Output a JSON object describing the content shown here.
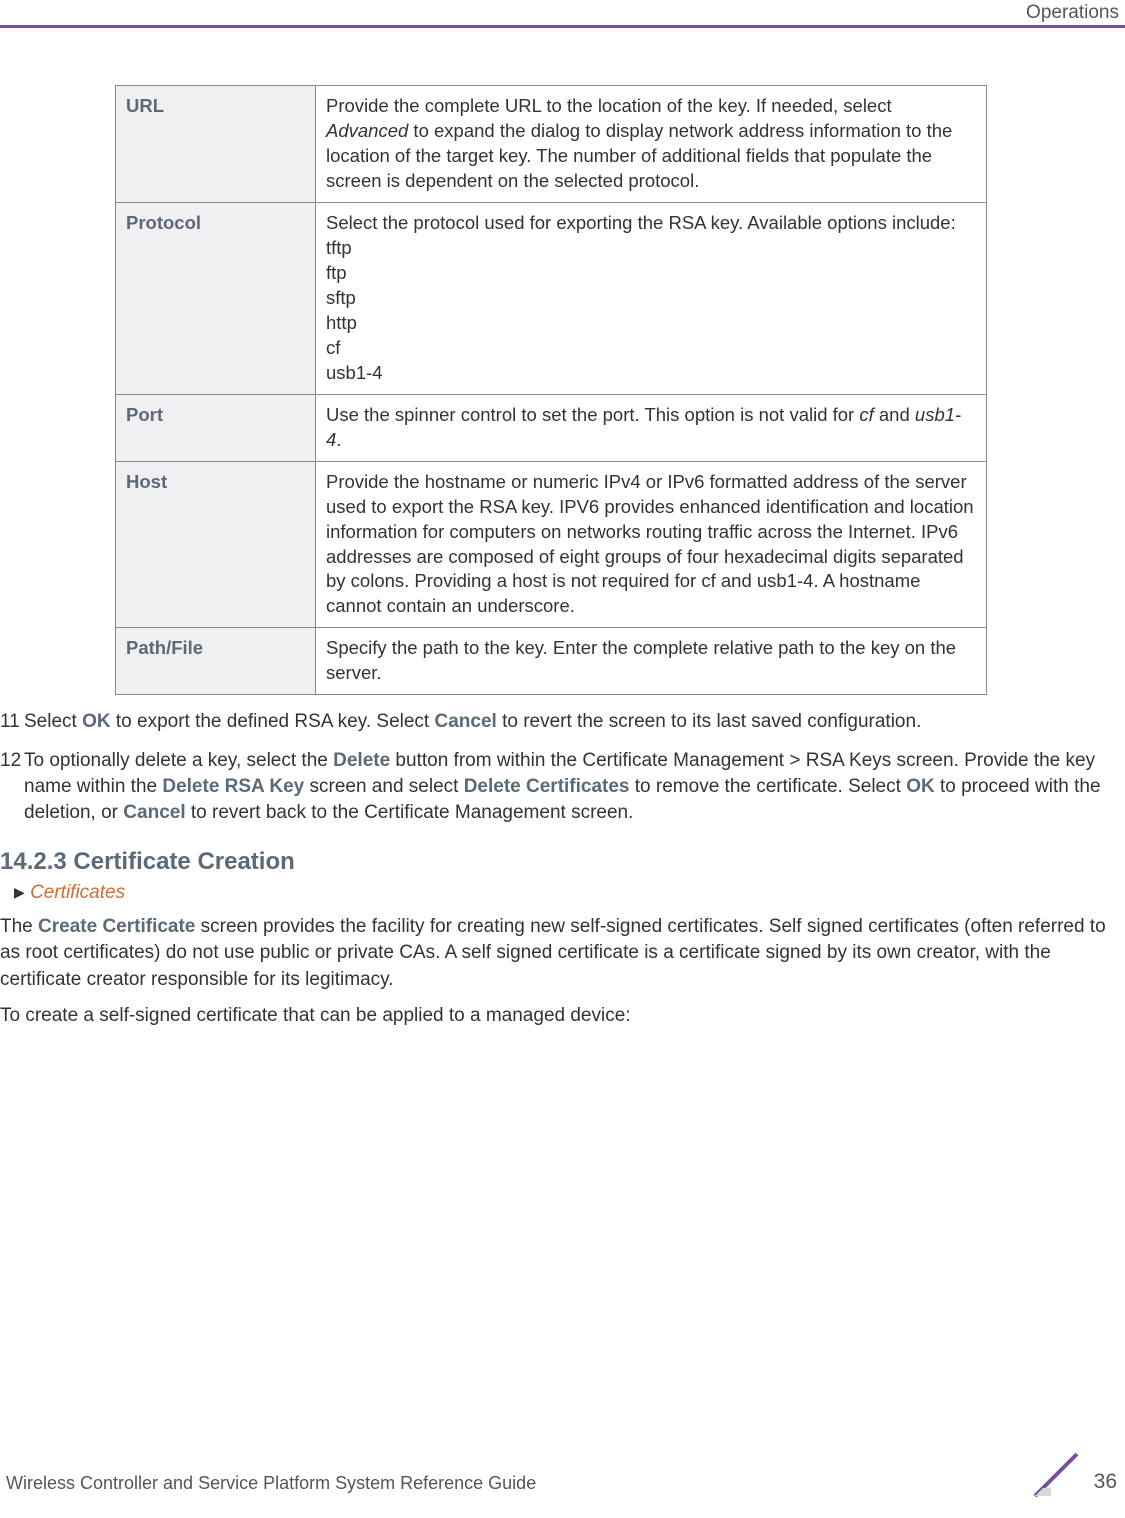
{
  "header": {
    "section": "Operations"
  },
  "table": {
    "rows": [
      {
        "label": "URL",
        "desc_html": "Provide the complete URL to the location of the key. If needed, select <span class=\"italic\">Advanced</span> to expand the dialog to display network address information to the location of the target key. The number of additional fields that populate the screen is dependent on the selected protocol."
      },
      {
        "label": "Protocol",
        "desc_html": "Select the protocol used for exporting the RSA key. Available options include:<span class=\"proto-line\">tftp</span><span class=\"proto-line\">ftp</span><span class=\"proto-line\">sftp</span><span class=\"proto-line\">http</span><span class=\"proto-line\">cf</span><span class=\"proto-line\">usb1-4</span>"
      },
      {
        "label": "Port",
        "desc_html": "Use the spinner control to set the port. This option is not valid for <span class=\"italic\">cf</span> and <span class=\"italic\">usb1-4</span>."
      },
      {
        "label": "Host",
        "desc_html": "Provide the hostname or numeric IPv4 or IPv6 formatted address of the server used to export the RSA key. IPV6 provides enhanced identification and location information for computers on networks routing traffic across the Internet. IPv6 addresses are composed of eight groups of four hexadecimal digits separated by colons. Providing a host is not required for cf and usb1-4. A hostname cannot contain an underscore."
      },
      {
        "label": "Path/File",
        "desc_html": "Specify the path to the key. Enter the complete relative path to the key on the server."
      }
    ]
  },
  "steps": [
    {
      "num": "11",
      "html": "Select <span class=\"b\">OK</span> to export the defined RSA key. Select <span class=\"b\">Cancel</span> to revert the screen to its last saved configuration."
    },
    {
      "num": "12",
      "html": "To optionally delete a key, select the <span class=\"b\">Delete</span> button from within the Certificate Management &gt; RSA Keys screen. Provide the key name within the <span class=\"b\">Delete RSA Key</span> screen and select <span class=\"b\">Delete Certificates</span> to remove the certificate. Select <span class=\"b\">OK</span> to proceed with the deletion, or <span class=\"b\">Cancel</span> to revert back to the Certificate Management screen."
    }
  ],
  "section": {
    "heading": "14.2.3 Certificate Creation",
    "crumb": "Certificates",
    "para1_html": "The <span class=\"b\">Create Certificate</span> screen provides the facility for creating new self-signed certificates. Self signed certificates (often referred to as root certificates) do not use public or private CAs. A self signed certificate is a certificate signed by its own creator, with the certificate creator responsible for its legitimacy.",
    "para2": "To create a self-signed certificate that can be applied to a managed device:"
  },
  "footer": {
    "left": "Wireless Controller and Service Platform System Reference Guide",
    "page": "36"
  }
}
